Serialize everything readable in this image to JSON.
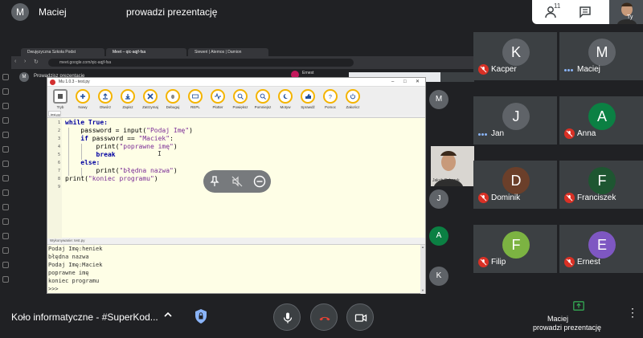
{
  "top": {
    "presenter_initial": "M",
    "presenter_name": "Maciej",
    "presenting_label": "prowadzi prezentację",
    "people_count": "11",
    "self_label": "Ty"
  },
  "browser": {
    "tabs": [
      "Dwujęzyczna Szkoła Podst",
      "Meet – qic-aqjf-fsa",
      "Sieweri | Atemos | Damion"
    ],
    "url": "meet.google.com/qic-aqjf-fsa"
  },
  "inner_meet": {
    "presenter_initial": "M",
    "presenting_label": "Prowadzisz prezentację",
    "participant_name": "Ernest",
    "tile_initials": [
      "M",
      "J",
      "A",
      "K"
    ],
    "tile_colors": [
      "#5f6368",
      "#5f6368",
      "#0b8043",
      "#5f6368"
    ],
    "video_label": "Jakub Sobczyk"
  },
  "mu": {
    "title": "Mu 1.0.3 - test.py",
    "toolbar": [
      "Tryb",
      "Nowy",
      "Otwórz",
      "Zapisz",
      "Zatrzymaj",
      "Debuguj",
      "REPL",
      "Plotter",
      "Powiększ",
      "Pomniejsz",
      "Motyw",
      "Sprawdź",
      "Pomoc",
      "Zakończ"
    ],
    "file_tab": "test.py",
    "line_numbers": [
      "1",
      "2",
      "3",
      "4",
      "5",
      "6",
      "7",
      "8",
      "9"
    ],
    "repl_label": "Wykonywanie: test.py",
    "repl_lines": [
      "Podaj Imę:heniek",
      "błędna nazwa",
      "Podaj Imę:Maciek",
      "poprawne imę",
      "koniec programu",
      ">>>"
    ]
  },
  "code": {
    "l1_kw": "while True:",
    "l2_pre": "    password = input(",
    "l2_str": "\"Podaj Imę\"",
    "l2_post": ")",
    "l3_kw": "    if",
    "l3_mid": " password == ",
    "l3_str": "\"Maciek\"",
    "l3_post": ":",
    "l4_pre": "        print(",
    "l4_str": "\"poprawne imę\"",
    "l4_post": ")",
    "l5_kw": "        break",
    "l6_kw": "    else:",
    "l7_pre": "        print(",
    "l7_str": "\"błędna nazwa\"",
    "l7_post": ")",
    "l8_pre": "print(",
    "l8_str": "\"koniec programu\"",
    "l8_post": ")"
  },
  "participants": [
    {
      "initial": "K",
      "name": "Kacper",
      "color": "#5f6368",
      "state": "muted"
    },
    {
      "initial": "M",
      "name": "Maciej",
      "color": "#5f6368",
      "state": "speaking"
    },
    {
      "initial": "J",
      "name": "Jan",
      "color": "#5f6368",
      "state": "speaking"
    },
    {
      "initial": "A",
      "name": "Anna",
      "color": "#0b8043",
      "state": "muted"
    },
    {
      "initial": "D",
      "name": "Dominik",
      "color": "#6b3f2a",
      "state": "muted"
    },
    {
      "initial": "F",
      "name": "Franciszek",
      "color": "#1e5631",
      "state": "muted"
    },
    {
      "initial": "F",
      "name": "Filip",
      "color": "#7cb342",
      "state": "muted"
    },
    {
      "initial": "E",
      "name": "Ernest",
      "color": "#7e57c2",
      "state": "muted"
    }
  ],
  "bottom": {
    "meeting_name": "Koło informatyczne - #SuperKod...",
    "presenter_name": "Maciej",
    "presenting_status": "prowadzi prezentację"
  },
  "colors": {
    "background": "#202124",
    "tile": "#3c4043",
    "mic_off": "#d93025",
    "mu_accent": "#f4b400",
    "hangup": "#ea4335"
  }
}
